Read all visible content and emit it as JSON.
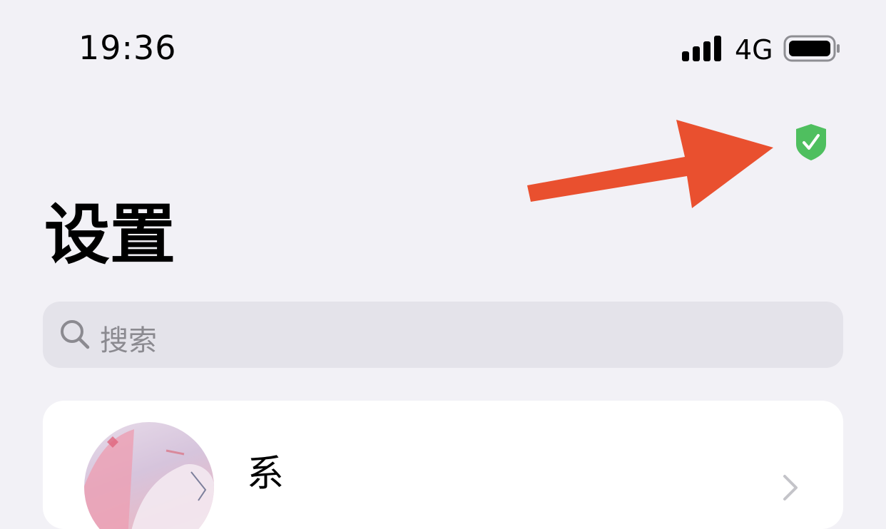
{
  "status_bar": {
    "time": "19:36",
    "network": "4G",
    "signal_icon": "cellular-signal-icon",
    "battery_icon": "battery-icon"
  },
  "header": {
    "verified_icon": "shield-check-icon",
    "annotation_icon": "red-arrow-annotation"
  },
  "page": {
    "title": "设置"
  },
  "search": {
    "placeholder": "搜索",
    "icon": "search-icon"
  },
  "profile": {
    "name": "系",
    "avatar_icon": "avatar",
    "chevron_icon": "chevron-right-icon"
  },
  "colors": {
    "background": "#f2f1f6",
    "search_bg": "#e4e3ea",
    "card_bg": "#ffffff",
    "shield_green": "#4fbf5f",
    "arrow_red": "#e9502f"
  }
}
